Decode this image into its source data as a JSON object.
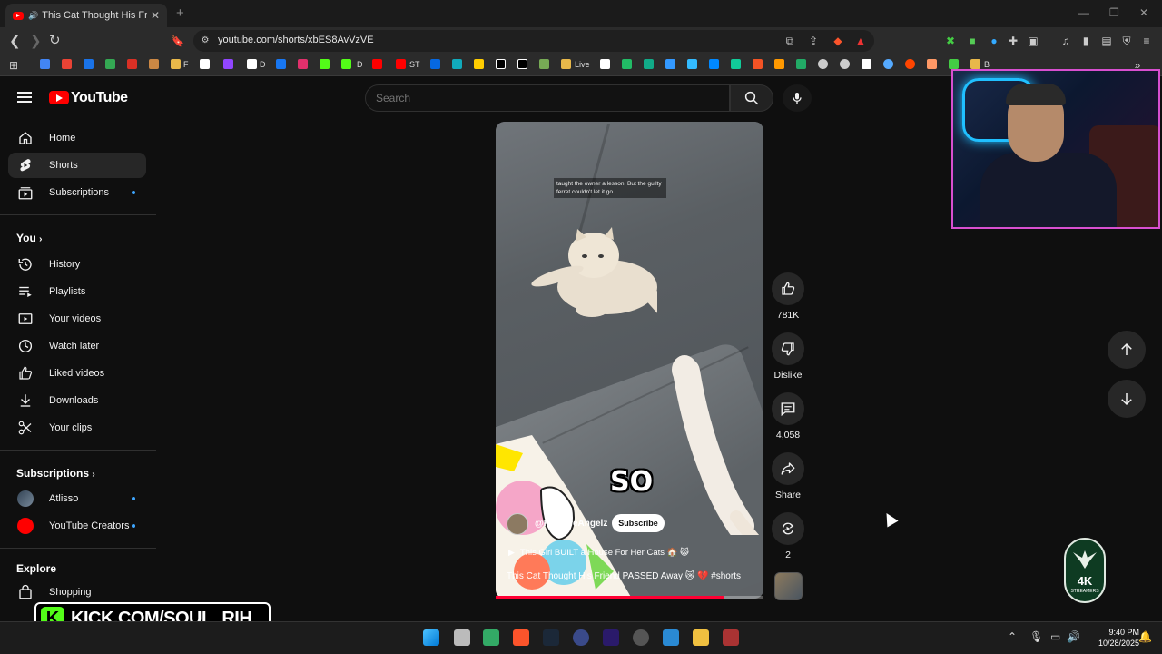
{
  "browser": {
    "tab_title": "This Cat Thought His Friend P",
    "url": "youtube.com/shorts/xbES8AvVzVE",
    "bookmark_labels": [
      "F",
      "D",
      "D",
      "ST",
      "Live",
      "B"
    ]
  },
  "header": {
    "logo_text": "YouTube",
    "search_placeholder": "Search"
  },
  "sidebar": {
    "main": [
      {
        "label": "Home",
        "icon": "home-icon"
      },
      {
        "label": "Shorts",
        "icon": "shorts-icon",
        "active": true
      },
      {
        "label": "Subscriptions",
        "icon": "subscriptions-icon",
        "dot": true
      }
    ],
    "you_heading": "You",
    "you": [
      {
        "label": "History",
        "icon": "history-icon"
      },
      {
        "label": "Playlists",
        "icon": "playlists-icon"
      },
      {
        "label": "Your videos",
        "icon": "your-videos-icon"
      },
      {
        "label": "Watch later",
        "icon": "watch-later-icon"
      },
      {
        "label": "Liked videos",
        "icon": "liked-videos-icon"
      },
      {
        "label": "Downloads",
        "icon": "downloads-icon"
      },
      {
        "label": "Your clips",
        "icon": "clips-icon"
      }
    ],
    "subs_heading": "Subscriptions",
    "subs": [
      {
        "label": "Atlisso",
        "dot": true
      },
      {
        "label": "YouTube Creators",
        "dot": true
      }
    ],
    "explore_heading": "Explore",
    "explore": [
      {
        "label": "Shopping",
        "icon": "shopping-icon"
      }
    ]
  },
  "short": {
    "caption_overlay": "taught the owner a lesson. But the guilty ferret couldn't let it go.",
    "subtitle_word": "SO",
    "channel": "@PetsAreAngelz",
    "subscribe_label": "Subscribe",
    "related": "This Girl BUILT a House For Her Cats 🏠 😺",
    "title": "This Cat Thought His Friend PASSED Away 😿 💔 #shorts",
    "progress": 0.85
  },
  "actions": {
    "likes": "781K",
    "dislike": "Dislike",
    "comments": "4,058",
    "share": "Share",
    "remix": "2"
  },
  "overlays": {
    "kick_text": "KICK.COM/SOUL_RIH",
    "badge_big": "4K",
    "badge_small": "STREAMERS"
  },
  "taskbar": {
    "time": "9:40 PM",
    "date": "10/28/2025"
  },
  "colors": {
    "brand_red": "#ff0000",
    "accent_blue": "#3ea6ff",
    "kick_green": "#53fc18"
  }
}
